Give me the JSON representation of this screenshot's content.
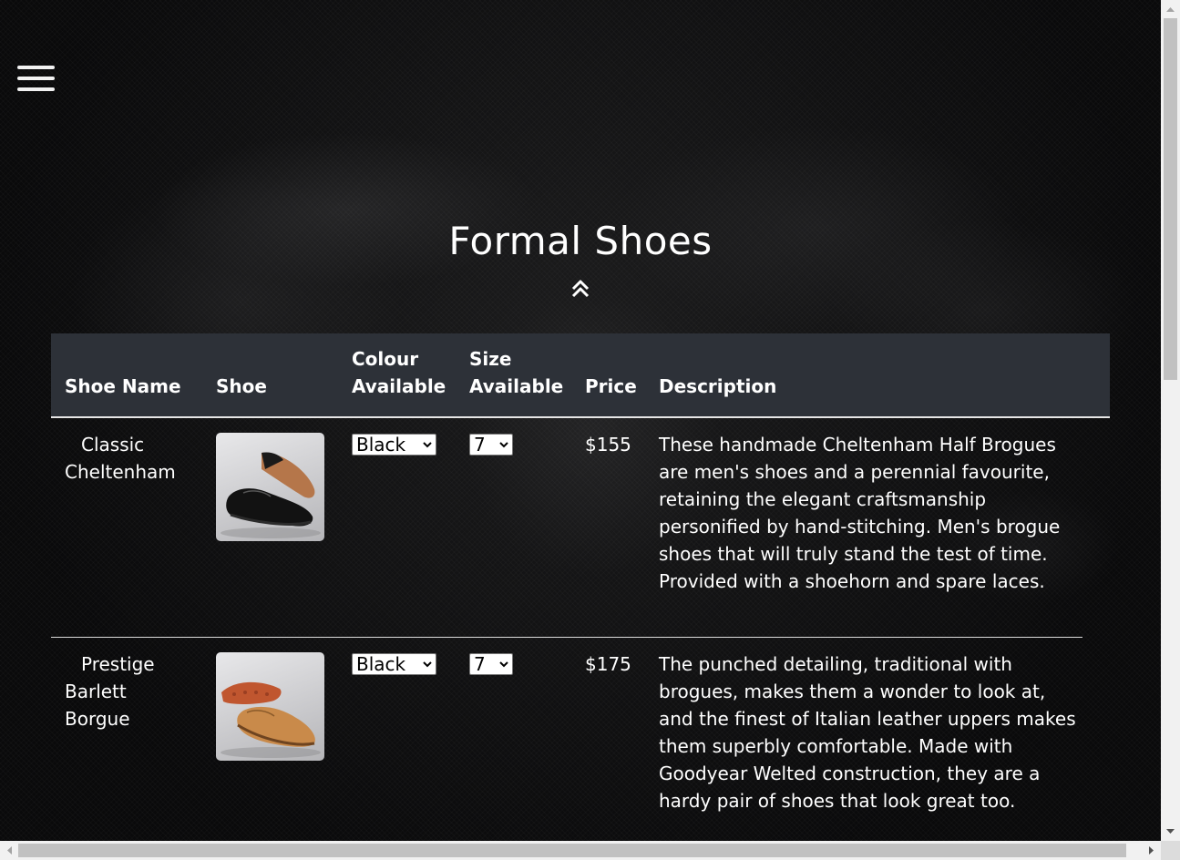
{
  "page": {
    "title": "Formal Shoes"
  },
  "nav": {
    "menu_icon": "hamburger-menu-icon",
    "scroll_top_icon": "double-chevron-up-icon"
  },
  "table": {
    "headers": {
      "name": "Shoe Name",
      "shoe": "Shoe",
      "colour_line1": "Colour",
      "colour_line2": "Available",
      "size_line1": "Size",
      "size_line2": "Available",
      "price": "Price",
      "description": "Description"
    },
    "rows": [
      {
        "name_line1": "Classic",
        "name_line2": "Cheltenham",
        "name_line3": "",
        "image": "black-brogue-shoe-image",
        "colour": "Black",
        "size": "7",
        "price": "$155",
        "description": "These handmade Cheltenham Half Brogues are men's shoes and a perennial favourite, retaining the elegant craftsmanship personified by hand-stitching. Men's brogue shoes that will truly stand the test of time. Provided with a shoehorn and spare laces."
      },
      {
        "name_line1": "Prestige",
        "name_line2": "Barlett",
        "name_line3": "Borgue",
        "image": "tan-brogue-shoe-image",
        "colour": "Black",
        "size": "7",
        "price": "$175",
        "description": "The punched detailing, traditional with brogues, makes them a wonder to look at, and the finest of Italian leather uppers makes them superbly comfortable. Made with Goodyear Welted construction, they are a hardy pair of shoes that look great too."
      }
    ]
  },
  "colors": {
    "header_bg": "#2d3138",
    "text": "#ffffff",
    "background": "#0b0b0c"
  }
}
